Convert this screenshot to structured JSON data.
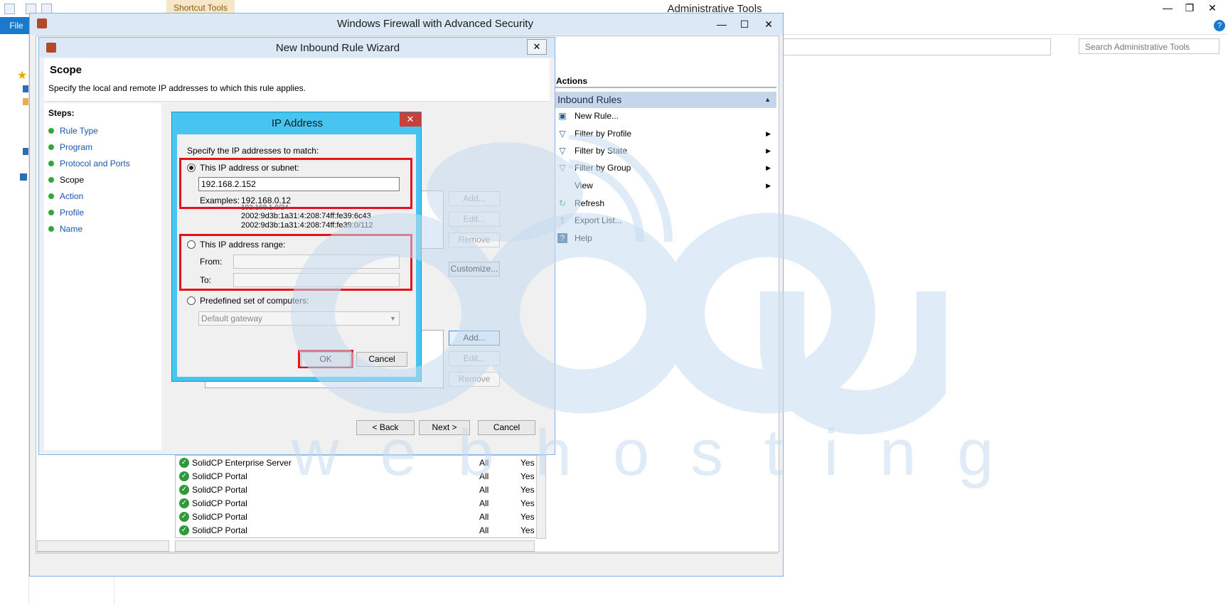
{
  "explorer": {
    "title": "Administrative Tools",
    "context_tab": "Shortcut Tools",
    "file_tab": "File",
    "search_placeholder": "Search Administrative Tools",
    "window_controls": [
      "—",
      "❐",
      "✕"
    ]
  },
  "mmc": {
    "title": "Windows Firewall with Advanced Security",
    "window_controls": [
      "—",
      "☐",
      "✕"
    ],
    "actions": {
      "header": "Actions",
      "section": "Inbound Rules",
      "items": [
        {
          "label": "New Rule...",
          "icon": "new-rule-icon",
          "submenu": false
        },
        {
          "label": "Filter by Profile",
          "icon": "filter-icon",
          "submenu": true
        },
        {
          "label": "Filter by State",
          "icon": "filter-icon",
          "submenu": true
        },
        {
          "label": "Filter by Group",
          "icon": "filter-icon",
          "submenu": true
        },
        {
          "label": "View",
          "icon": "",
          "submenu": true
        },
        {
          "label": "Refresh",
          "icon": "refresh-icon",
          "submenu": false
        },
        {
          "label": "Export List...",
          "icon": "export-icon",
          "submenu": false
        },
        {
          "label": "Help",
          "icon": "help-icon",
          "submenu": false
        }
      ]
    },
    "rules": [
      {
        "name": "SolidCP Enterprise Server",
        "profile": "All",
        "enabled": "Yes"
      },
      {
        "name": "SolidCP Portal",
        "profile": "All",
        "enabled": "Yes"
      },
      {
        "name": "SolidCP Portal",
        "profile": "All",
        "enabled": "Yes"
      },
      {
        "name": "SolidCP Portal",
        "profile": "All",
        "enabled": "Yes"
      },
      {
        "name": "SolidCP Portal",
        "profile": "All",
        "enabled": "Yes"
      },
      {
        "name": "SolidCP Portal",
        "profile": "All",
        "enabled": "Yes"
      }
    ]
  },
  "wizard": {
    "title": "New Inbound Rule Wizard",
    "close": "✕",
    "page_title": "Scope",
    "page_desc": "Specify the local and remote IP addresses to which this rule applies.",
    "steps_label": "Steps:",
    "steps": [
      "Rule Type",
      "Program",
      "Protocol and Ports",
      "Scope",
      "Action",
      "Profile",
      "Name"
    ],
    "current_step": "Scope",
    "list_buttons_top": [
      "Add...",
      "Edit...",
      "Remove"
    ],
    "customize": "Customize...",
    "list_buttons_bottom": [
      "Add...",
      "Edit...",
      "Remove"
    ],
    "back": "< Back",
    "next": "Next >",
    "cancel": "Cancel"
  },
  "ip_dialog": {
    "title": "IP Address",
    "close": "✕",
    "instruction": "Specify the IP addresses to match:",
    "option_subnet": "This IP address or subnet:",
    "subnet_value": "192.168.2.152",
    "examples_label": "Examples:",
    "examples": [
      "192.168.0.12",
      "192.168.1.0/24",
      "2002:9d3b:1a31:4:208:74ff:fe39:6c43",
      "2002:9d3b:1a31:4:208:74ff:fe39:0/112"
    ],
    "option_range": "This IP address range:",
    "from_label": "From:",
    "to_label": "To:",
    "option_predefined": "Predefined set of computers:",
    "predefined_value": "Default gateway",
    "ok": "OK",
    "cancel": "Cancel"
  },
  "watermark": {
    "brand": "accu",
    "sub": "webhosting"
  }
}
